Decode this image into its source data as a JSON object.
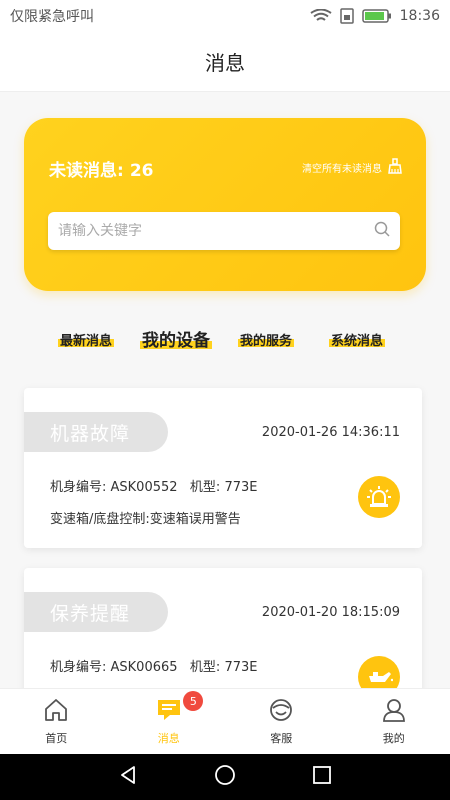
{
  "status_bar": {
    "left_text": "仅限紧急呼叫",
    "time": "18:36"
  },
  "header": {
    "title": "消息"
  },
  "banner": {
    "unread_label": "未读消息:",
    "unread_count": "26",
    "clear_label": "清空所有未读消息",
    "search_placeholder": "请输入关键字"
  },
  "tabs": [
    "最新消息",
    "我的设备",
    "我的服务",
    "系统消息"
  ],
  "cards": [
    {
      "tag": "机器故障",
      "time": "2020-01-26 14:36:11",
      "line1": "机身编号: ASK00552   机型: 773E",
      "line2": "变速箱/底盘控制:变速箱误用警告",
      "icon": "alarm-light-icon"
    },
    {
      "tag": "保养提醒",
      "time": "2020-01-20 18:15:09",
      "line1": "机身编号: ASK00665   机型: 773E",
      "line2": "",
      "icon": "oil-can-icon"
    }
  ],
  "tabbar": {
    "items": [
      "首页",
      "消息",
      "客服",
      "我的"
    ],
    "badge": "5",
    "active": "消息"
  },
  "colors": {
    "accent": "#ffc40f",
    "badge": "#f04a3e",
    "tag_bg": "#e3e3e3"
  }
}
